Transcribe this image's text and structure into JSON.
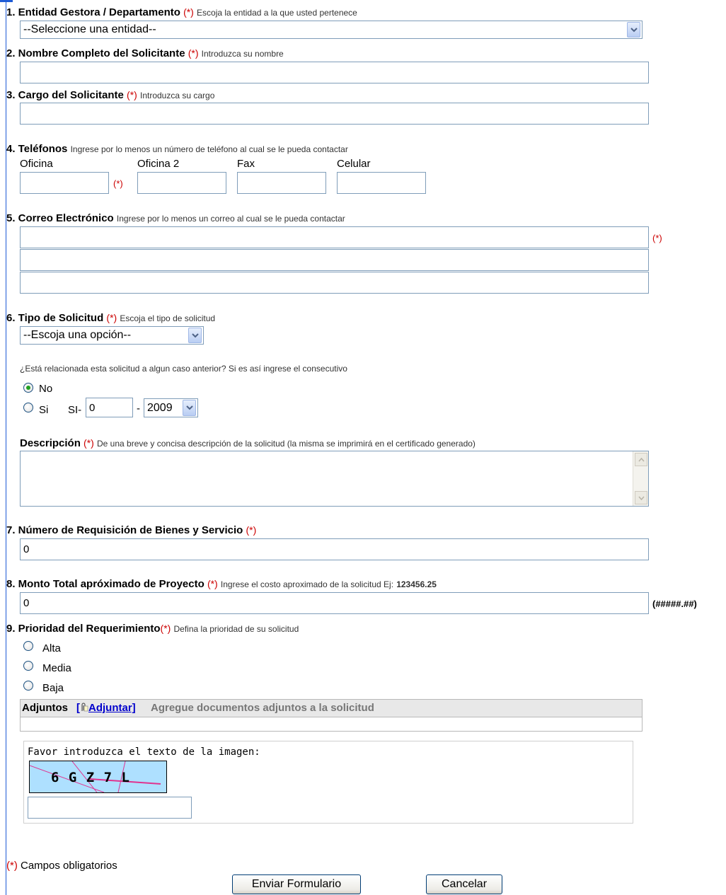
{
  "form": {
    "req_mark": "(*)",
    "entidad": {
      "label": "1. Entidad Gestora / Departamento",
      "hint": "Escoja la entidad a la que usted pertenece",
      "selected": "--Seleccione una entidad--"
    },
    "nombre": {
      "label": "2. Nombre Completo del Solicitante",
      "hint": "Introduzca su nombre",
      "value": ""
    },
    "cargo": {
      "label": "3. Cargo del Solicitante",
      "hint": "Introduzca su cargo",
      "value": ""
    },
    "telefonos": {
      "label": "4. Teléfonos",
      "hint": "Ingrese por lo menos un número de teléfono al cual se le pueda contactar",
      "oficina": "Oficina",
      "oficina2": "Oficina 2",
      "fax": "Fax",
      "celular": "Celular"
    },
    "correo": {
      "label": "5. Correo Electrónico",
      "hint": "Ingrese por lo menos un correo al cual se le pueda contactar"
    },
    "tipo": {
      "label": "6. Tipo de Solicitud",
      "hint": "Escoja el tipo de solicitud",
      "selected": "--Escoja una opción--",
      "related_question": "¿Está relacionada esta solicitud a algun caso anterior? Si es así ingrese el consecutivo",
      "no_label": "No",
      "si_label": "Si",
      "prefix": "SI-",
      "consecutivo_value": "0",
      "dash": "-",
      "year_selected": "2009"
    },
    "descripcion": {
      "label": "Descripción",
      "hint": "De una breve y concisa descripción de la solicitud (la misma se imprimirá en el certificado generado)"
    },
    "requisicion": {
      "label": "7. Número de Requisición de Bienes y Servicio",
      "value": "0"
    },
    "monto": {
      "label": "8. Monto Total apróximado de Proyecto",
      "hint": "Ingrese el costo aproximado de la solicitud Ej:",
      "example": "123456.25",
      "value": "0",
      "format": "(#####.##)"
    },
    "prioridad": {
      "label": "9. Prioridad del Requerimiento",
      "hint": "Defina la prioridad de su solicitud",
      "options": [
        "Alta",
        "Media",
        "Baja"
      ]
    },
    "adjuntos": {
      "label": "Adjuntos",
      "link_open": "[",
      "link_text": "Adjuntar]",
      "hint": "Agregue documentos adjuntos a la solicitud"
    },
    "captcha": {
      "instruction": "Favor introduzca el texto de la imagen:",
      "image_text": "6 G Z 7 L",
      "value": ""
    },
    "footer": {
      "mandatory_note": "Campos obligatorios",
      "submit_label": "Enviar Formulario",
      "cancel_label": "Cancelar"
    }
  }
}
